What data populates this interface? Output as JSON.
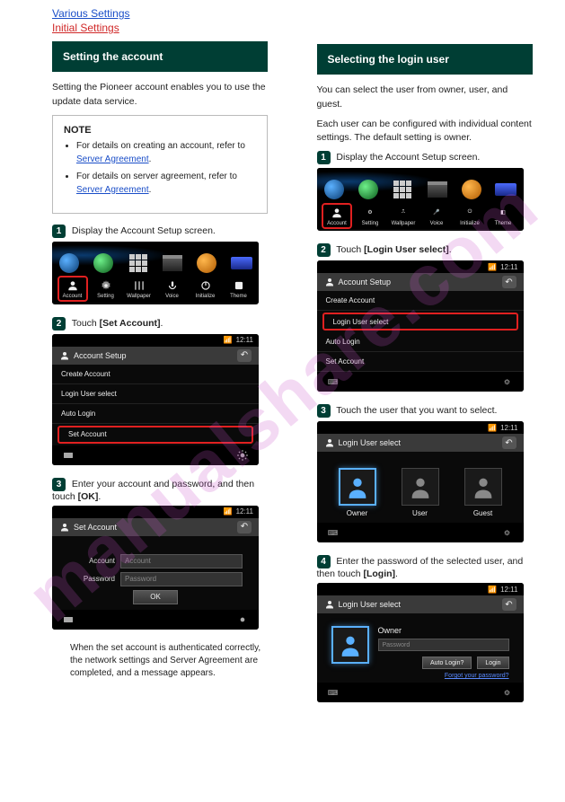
{
  "watermark": "manualshare.com",
  "left": {
    "section_link": "Various Settings",
    "section_red": "Initial Settings",
    "heading": "Setting the account",
    "intro": "Setting the Pioneer account enables you to use the update data service.",
    "note_title": "NOTE",
    "note_items_pre1": "For details on creating an account, refer to ",
    "note_link1": "Server Agreement",
    "note_items_pre2": "For details on server agreement, refer to ",
    "note_link2": "Server Agreement",
    "steps": {
      "s1": {
        "label": "Display the Account Setup screen."
      },
      "s2": {
        "pre": "Touch ",
        "bold": "[Set Account]",
        "post": "."
      },
      "s3": {
        "pre": "Enter your account and password, and then touch ",
        "bold": "[OK]",
        "post": ".",
        "sub": "When the set account is authenticated correctly, the network settings and Server Agreement are completed, and a message appears."
      }
    },
    "mock": {
      "status_time": "12:11",
      "title": "Account Setup",
      "rows": [
        "Create Account",
        "Login User select",
        "Auto Login",
        "Set Account"
      ],
      "setaccount_title": "Set Account",
      "form_account_label": "Account",
      "form_account_ph": "Account",
      "form_password_label": "Password",
      "form_password_ph": "Password",
      "ok": "OK",
      "settings_items": [
        "Account",
        "Setting",
        "Wallpaper",
        "Voice",
        "Initialize",
        "Theme"
      ]
    }
  },
  "right": {
    "heading": "Selecting the login user",
    "intro1": "You can select the user from owner, user, and guest.",
    "intro2": "Each user can be configured with individual content settings. The default setting is owner.",
    "steps": {
      "s1": {
        "label": "Display the Account Setup screen."
      },
      "s2": {
        "pre": "Touch ",
        "bold": "[Login User select]",
        "post": "."
      },
      "s3": {
        "label": "Touch the user that you want to select."
      },
      "s4": {
        "pre": "Enter the password of the selected user, and then touch ",
        "bold": "[Login]",
        "post": "."
      }
    },
    "mock": {
      "status_time": "12:11",
      "title": "Account Setup",
      "rows": [
        "Create Account",
        "Login User select",
        "Auto Login",
        "Set Account"
      ],
      "login_select_title": "Login User select",
      "users": [
        "Owner",
        "User",
        "Guest"
      ],
      "login_panel": {
        "name": "Owner",
        "password_ph": "Password",
        "auto_login": "Auto Login?",
        "login": "Login",
        "forgot": "Forgot your password?"
      },
      "settings_items": [
        "Account",
        "Setting",
        "Wallpaper",
        "Voice",
        "Initialize",
        "Theme"
      ]
    }
  }
}
